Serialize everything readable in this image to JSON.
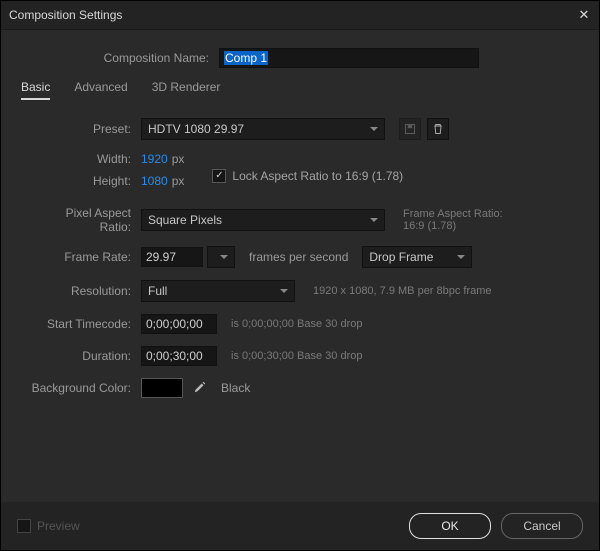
{
  "window": {
    "title": "Composition Settings"
  },
  "compName": {
    "label": "Composition Name:",
    "value": "Comp 1"
  },
  "tabs": {
    "basic": "Basic",
    "advanced": "Advanced",
    "renderer": "3D Renderer"
  },
  "preset": {
    "label": "Preset:",
    "value": "HDTV 1080 29.97"
  },
  "width": {
    "label": "Width:",
    "value": "1920",
    "unit": "px"
  },
  "height": {
    "label": "Height:",
    "value": "1080",
    "unit": "px"
  },
  "lockAspect": {
    "checked": true,
    "label": "Lock Aspect Ratio to 16:9 (1.78)"
  },
  "par": {
    "label": "Pixel Aspect Ratio:",
    "value": "Square Pixels"
  },
  "frameAspect": {
    "label": "Frame Aspect Ratio:",
    "value": "16:9 (1.78)"
  },
  "frameRate": {
    "label": "Frame Rate:",
    "value": "29.97",
    "unit": "frames per second",
    "drop": "Drop Frame"
  },
  "resolution": {
    "label": "Resolution:",
    "value": "Full",
    "hint": "1920 x 1080, 7.9 MB per 8bpc frame"
  },
  "startTC": {
    "label": "Start Timecode:",
    "value": "0;00;00;00",
    "hint": "is 0;00;00;00  Base 30  drop"
  },
  "duration": {
    "label": "Duration:",
    "value": "0;00;30;00",
    "hint": "is 0;00;30;00  Base 30  drop"
  },
  "bgColor": {
    "label": "Background Color:",
    "name": "Black",
    "hex": "#000000"
  },
  "footer": {
    "preview": "Preview",
    "ok": "OK",
    "cancel": "Cancel"
  }
}
